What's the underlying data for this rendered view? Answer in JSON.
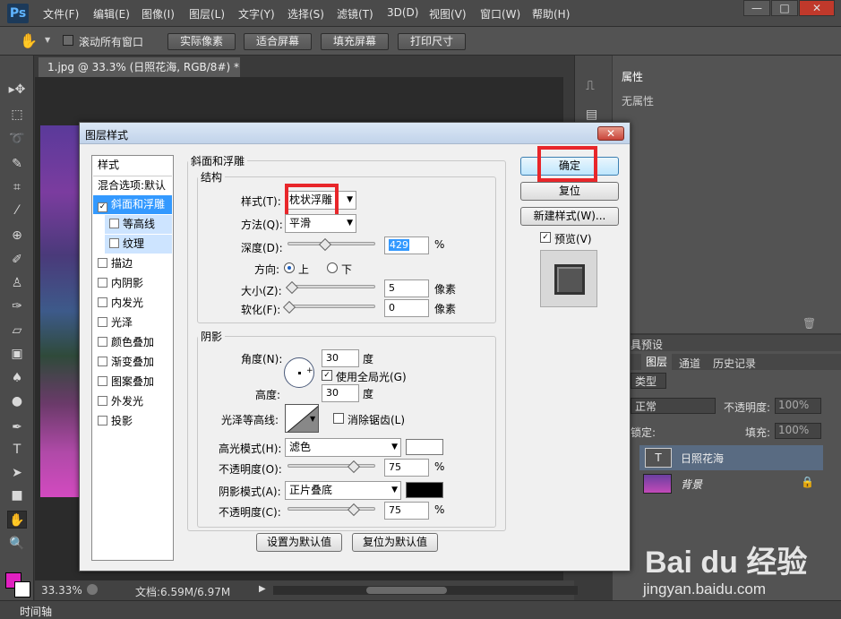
{
  "app": {
    "logo": "Ps"
  },
  "menu": [
    "文件(F)",
    "编辑(E)",
    "图像(I)",
    "图层(L)",
    "文字(Y)",
    "选择(S)",
    "滤镜(T)",
    "3D(D)",
    "视图(V)",
    "窗口(W)",
    "帮助(H)"
  ],
  "window_controls": {
    "minimize": "—",
    "restore": "□",
    "close": "✕"
  },
  "options": {
    "scroll_all": "滚动所有窗口",
    "actual_pixels": "实际像素",
    "fit_screen": "适合屏幕",
    "fill_screen": "填充屏幕",
    "print_size": "打印尺寸"
  },
  "document": {
    "tab": "1.jpg @ 33.3% (日照花海, RGB/8#) *",
    "zoom": "33.33%",
    "docsize": "文档:6.59M/6.97M"
  },
  "timeline": "时间轴",
  "properties": {
    "title": "属性",
    "empty": "无属性"
  },
  "layers": {
    "tab_adjust": "具预设",
    "tab_layers": "图层",
    "tab_channels": "通道",
    "tab_history": "历史记录",
    "kind": "类型",
    "blend": "正常",
    "opacity_label": "不透明度:",
    "opacity": "100%",
    "lock_label": "锁定:",
    "fill_label": "填充:",
    "fill": "100%",
    "layer1": "日照花海",
    "layer2": "背景"
  },
  "dialog": {
    "title": "图层样式",
    "close": "✕",
    "styles_header": "样式",
    "blend_options": "混合选项:默认",
    "items": [
      {
        "label": "斜面和浮雕",
        "checked": true
      },
      {
        "label": "等高线",
        "checked": false
      },
      {
        "label": "纹理",
        "checked": false
      },
      {
        "label": "描边",
        "checked": false
      },
      {
        "label": "内阴影",
        "checked": false
      },
      {
        "label": "内发光",
        "checked": false
      },
      {
        "label": "光泽",
        "checked": false
      },
      {
        "label": "颜色叠加",
        "checked": false
      },
      {
        "label": "渐变叠加",
        "checked": false
      },
      {
        "label": "图案叠加",
        "checked": false
      },
      {
        "label": "外发光",
        "checked": false
      },
      {
        "label": "投影",
        "checked": false
      }
    ],
    "bevel": {
      "group": "斜面和浮雕",
      "structure": "结构",
      "style_label": "样式(T):",
      "style": "枕状浮雕",
      "technique_label": "方法(Q):",
      "technique": "平滑",
      "depth_label": "深度(D):",
      "depth": "429",
      "pct": "%",
      "direction_label": "方向:",
      "up": "上",
      "down": "下",
      "size_label": "大小(Z):",
      "size": "5",
      "px": "像素",
      "soften_label": "软化(F):",
      "soften": "0"
    },
    "shading": {
      "group": "阴影",
      "angle_label": "角度(N):",
      "angle": "30",
      "deg": "度",
      "global_light": "使用全局光(G)",
      "altitude_label": "高度:",
      "altitude": "30",
      "gloss_label": "光泽等高线:",
      "antialias": "消除锯齿(L)",
      "highlight_label": "高光模式(H):",
      "highlight_mode": "滤色",
      "highlight_color": "#ffffff",
      "hl_opacity_label": "不透明度(O):",
      "hl_opacity": "75",
      "shadow_label": "阴影模式(A):",
      "shadow_mode": "正片叠底",
      "shadow_color": "#000000",
      "sh_opacity_label": "不透明度(C):",
      "sh_opacity": "75"
    },
    "make_default": "设置为默认值",
    "reset_default": "复位为默认值",
    "ok": "确定",
    "reset": "复位",
    "new_style": "新建样式(W)...",
    "preview": "预览(V)"
  },
  "watermark": {
    "brand": "Bai du 经验",
    "url": "jingyan.baidu.com"
  }
}
